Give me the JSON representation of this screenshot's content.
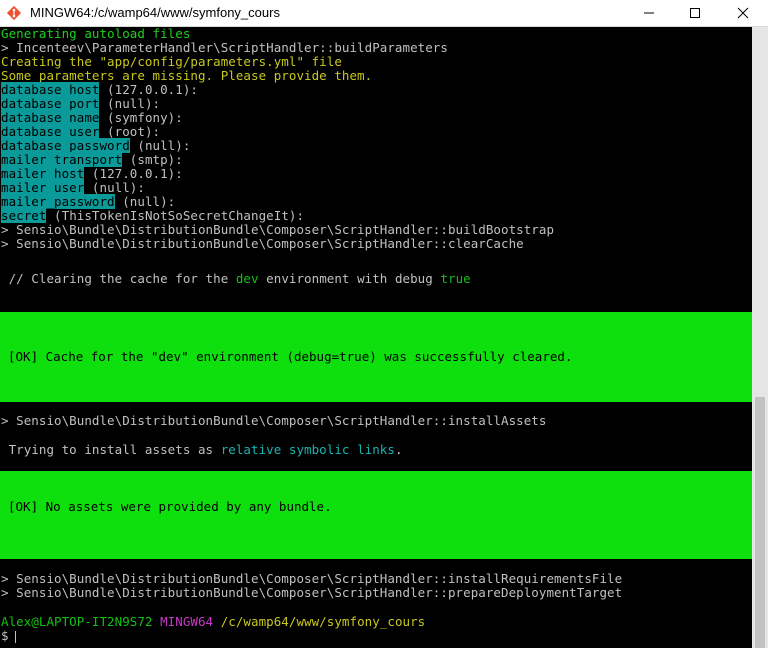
{
  "window": {
    "title": "MINGW64:/c/wamp64/www/symfony_cours"
  },
  "terminal": {
    "generating": "Generating autoload files",
    "build_params": "> Incenteev\\ParameterHandler\\ScriptHandler::buildParameters",
    "creating": "Creating the \"app/config/parameters.yml\" file",
    "missing": "Some parameters are missing. Please provide them.",
    "params": [
      {
        "key": "database_host",
        "value": " (127.0.0.1):"
      },
      {
        "key": "database_port",
        "value": " (null):"
      },
      {
        "key": "database_name",
        "value": " (symfony):"
      },
      {
        "key": "database_user",
        "value": " (root):"
      },
      {
        "key": "database_password",
        "value": " (null):"
      },
      {
        "key": "mailer_transport",
        "value": " (smtp):"
      },
      {
        "key": "mailer_host",
        "value": " (127.0.0.1):"
      },
      {
        "key": "mailer_user",
        "value": " (null):"
      },
      {
        "key": "mailer_password",
        "value": " (null):"
      },
      {
        "key": "secret",
        "value": " (ThisTokenIsNotSoSecretChangeIt):"
      }
    ],
    "build_bootstrap": "> Sensio\\Bundle\\DistributionBundle\\Composer\\ScriptHandler::buildBootstrap",
    "clear_cache": "> Sensio\\Bundle\\DistributionBundle\\Composer\\ScriptHandler::clearCache",
    "clearing_prefix": " // Clearing the cache for the ",
    "clearing_env": "dev",
    "clearing_mid": " environment with debug ",
    "clearing_debug": "true",
    "ok_cache": "[OK] Cache for the \"dev\" environment (debug=true) was successfully cleared.",
    "install_assets": "> Sensio\\Bundle\\DistributionBundle\\Composer\\ScriptHandler::installAssets",
    "trying_prefix": " Trying to install assets as ",
    "trying_link": "relative symbolic links",
    "trying_suffix": ".",
    "ok_assets": "[OK] No assets were provided by any bundle.",
    "install_req": "> Sensio\\Bundle\\DistributionBundle\\Composer\\ScriptHandler::installRequirementsFile",
    "prepare_deploy": "> Sensio\\Bundle\\DistributionBundle\\Composer\\ScriptHandler::prepareDeploymentTarget",
    "prompt_user": "Alex@LAPTOP-IT2N9S72",
    "prompt_sys": "MINGW64",
    "prompt_path": "/c/wamp64/www/symfony_cours",
    "prompt_symbol": "$"
  },
  "colors": {
    "terminal_bg": "#000000",
    "ok_block": "#0ee00e",
    "param_highlight": "#0b9a9a",
    "info_green": "#1bd21b",
    "info_yellow": "#c8c81e",
    "magenta": "#c837c8"
  },
  "icons": {
    "app": "git-bash-icon",
    "minimize": "minimize-icon",
    "maximize": "maximize-icon",
    "close": "close-icon"
  }
}
